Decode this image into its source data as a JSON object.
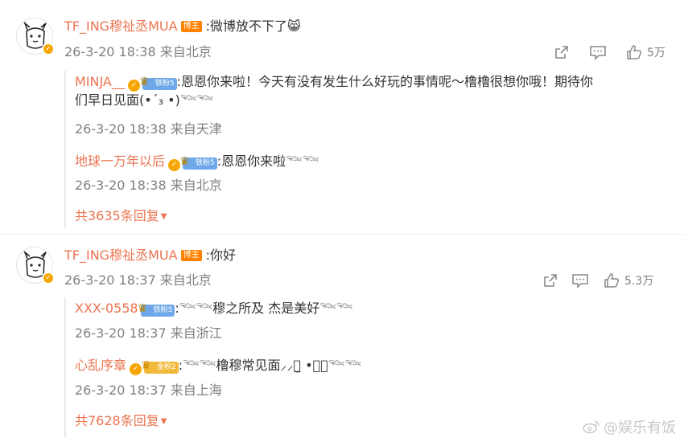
{
  "comments": [
    {
      "user": "TF_ING穆祉丞MUA",
      "host_tag": "博主",
      "text": ":微博放不下了😸",
      "meta": "26-3-20 18:38 来自北京",
      "likes": "5万",
      "replies": [
        {
          "user": "MINJA__",
          "fan_badge": "铁粉5",
          "text_line1": ":恩恩你来啦！今天有没有发生什么好玩的事情呢～橹橹很想你哦！期待你",
          "text_line2": "们早日见面(•´₃ •)𓆝𓆝",
          "meta": "26-3-20 18:38 来自天津"
        },
        {
          "user": "地球一万年以后",
          "fan_badge": "铁粉5",
          "text_line1": ":恩恩你来啦𓆝𓆝",
          "meta": "26-3-20 18:38 来自北京"
        }
      ],
      "more_replies": "共3635条回复"
    },
    {
      "user": "TF_ING穆祉丞MUA",
      "host_tag": "博主",
      "text": ":你好",
      "meta": "26-3-20 18:37 来自北京",
      "likes": "5.3万",
      "replies": [
        {
          "user": "XXX-0558",
          "fan_badge": "铁粉5",
          "text_line1": ":𓆝𓆝穆之所及 杰是美好𓆝𓆝",
          "meta": "26-3-20 18:37 来自浙江"
        },
        {
          "user": "心乱序章",
          "fan_badge": "金粉2",
          "text_line1": ":𓆝𓆝橹穆常见面⸝⸝っ̫ •⸝⸝𓆝𓆝",
          "meta": "26-3-20 18:37 来自上海"
        }
      ],
      "more_replies": "共7628条回复"
    }
  ],
  "watermark": "@娱乐有饭",
  "colors": {
    "username": "#eb7350",
    "meta": "#808080",
    "host_tag": "#ff8200",
    "verified": "#f7a600"
  },
  "icons": [
    "share-icon",
    "comment-icon",
    "like-icon",
    "chevron-down-icon",
    "verified-icon",
    "crown-icon",
    "weibo-icon"
  ]
}
